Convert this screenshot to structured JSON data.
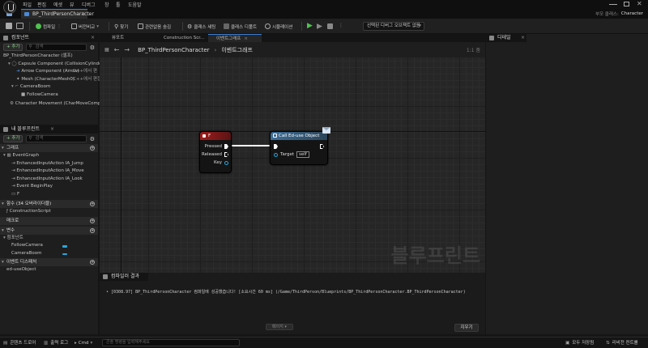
{
  "app": {
    "menu": [
      "파일",
      "편집",
      "에셋",
      "뷰",
      "디버그",
      "창",
      "툴",
      "도움말"
    ],
    "doc_tab": "BP_ThirdPersonCharacter",
    "parent_class_label": "부모 클래스:",
    "parent_class_value": "Character"
  },
  "toolbar": {
    "compile": "컴파일",
    "diff": "버전비교",
    "find": "찾기",
    "hide_unrelated": "관련없음 숨김",
    "class_settings": "클래스 세팅",
    "class_defaults": "클래스 디폴트",
    "simulation": "시뮬레이션",
    "debug_dropdown": "선택된 디버그 오브젝트 없음"
  },
  "components": {
    "title": "컴포넌트",
    "add_label": "+ 추가",
    "search_placeholder": "검색",
    "items": [
      "BP_ThirdPersonCharacter (셀프)",
      "Capsule Component (CollisionCylinder)",
      "Arrow Component (Arrow)",
      "Mesh (CharacterMesh0)",
      "CameraBoom",
      "FollowCamera",
      "Character Movement (CharMoveComp)"
    ],
    "inherited_tag": "C++에서 편",
    "inherited_tag2": "C++에서 편집"
  },
  "my_blueprint": {
    "title": "내 블루프린트",
    "add_label": "+ 추가",
    "search_placeholder": "검색",
    "graphs_label": "그래프",
    "event_graph": "EventGraph",
    "event_items": [
      "EnhancedInputAction IA_Jump",
      "EnhancedInputAction IA_Move",
      "EnhancedInputAction IA_Look",
      "Event BeginPlay",
      "F"
    ],
    "functions_label": "함수 (34 오버라이더블)",
    "construction_script": "ConstructionScript",
    "macros_label": "매크로",
    "variables_label": "변수",
    "components_label": "컴포넌트",
    "variables": [
      "FollowCamera",
      "CameraBoom"
    ],
    "dispatchers_label": "이벤트 디스패처",
    "dispatcher_item": "ed-useObject"
  },
  "graph": {
    "tabs": [
      "뷰포트",
      "Construction Scr...",
      "이벤트그래프"
    ],
    "breadcrumb_root": "BP_ThirdPersonCharacter",
    "breadcrumb_leaf": "이벤트그래프",
    "zoom": "1:1 줌",
    "watermark": "블루프린트",
    "node_f_title": "F",
    "node_f_pins": [
      "Pressed",
      "Released",
      "Key"
    ],
    "node_call_title": "Call Ed-use Object",
    "node_call_target_label": "Target",
    "node_call_target_value": "self"
  },
  "details": {
    "title": "디테일"
  },
  "output": {
    "title": "컴파일러 결과",
    "log_line": "[0308.97] BP_ThirdPersonCharacter 컴파일에 성공했습니다! [소요시간 60 ms] (/Game/ThirdPerson/Blueprints/BP_ThirdPersonCharacter.BP_ThirdPersonCharacter)",
    "page_button": "페이지",
    "clear_button": "지우기"
  },
  "statusbar": {
    "content_drawer": "콘텐츠 드로어",
    "output_log": "출력 로그",
    "cmd": "Cmd",
    "console_placeholder": "콘솔 명령을 입력해주세요",
    "save_all": "모두 저장됨",
    "source_control": "리비전 컨트롤"
  },
  "colors": {
    "accent": "#3c7fd8",
    "event_node": "#a01c1c",
    "function_node": "#3d6e98",
    "play": "#4fc24f"
  }
}
